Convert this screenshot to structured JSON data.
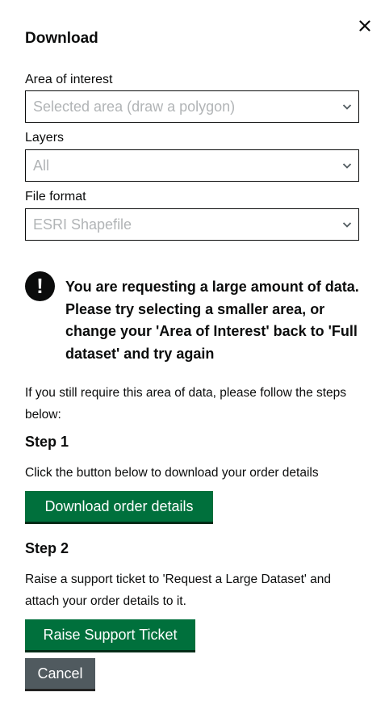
{
  "dialog": {
    "title": "Download",
    "close_icon": "close-icon"
  },
  "fields": {
    "area": {
      "label": "Area of interest",
      "value": "Selected area (draw a polygon)",
      "icon": "chevron-down-icon"
    },
    "layers": {
      "label": "Layers",
      "value": "All",
      "icon": "chevron-down-icon"
    },
    "format": {
      "label": "File format",
      "value": "ESRI Shapefile",
      "icon": "chevron-down-icon"
    }
  },
  "warning": {
    "icon": "warning-icon",
    "icon_glyph": "!",
    "text": "You are requesting a large amount of data. Please try selecting a smaller area, or change your 'Area of Interest' back to 'Full dataset' and try again"
  },
  "instructions": {
    "intro": "If you still require this area of data, please follow the steps below:",
    "step1": {
      "heading": "Step 1",
      "text": "Click the button below to download your order details",
      "button": "Download order details"
    },
    "step2": {
      "heading": "Step 2",
      "text": "Raise a support ticket to 'Request a Large Dataset' and attach your order details to it.",
      "button": "Raise Support Ticket"
    }
  },
  "actions": {
    "cancel": "Cancel"
  },
  "colors": {
    "primary_button": "#00703c",
    "secondary_button": "#505a5f",
    "text": "#0b0c0c",
    "disabled_text": "#b1b4b6"
  }
}
